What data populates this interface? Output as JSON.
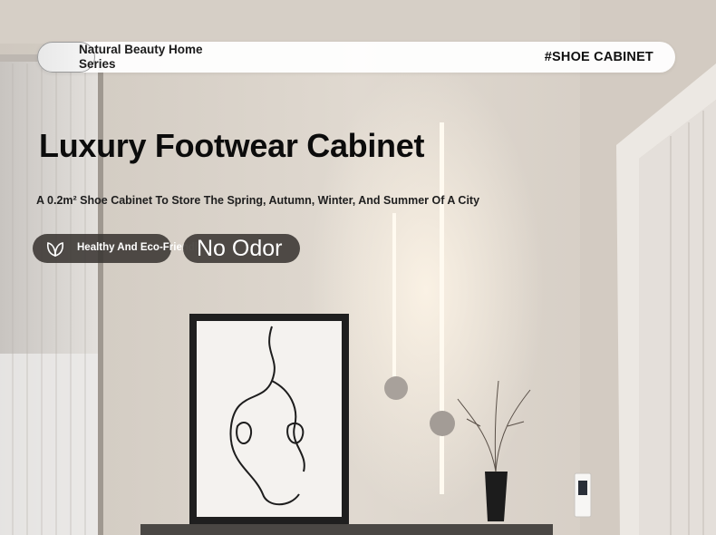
{
  "header": {
    "series_label": "Natural Beauty Home Series",
    "hashtag": "#SHOE CABINET"
  },
  "hero": {
    "title": "Luxury Footwear Cabinet",
    "subtitle": "A 0.2m² Shoe Cabinet To Store The Spring, Autumn, Winter, And Summer Of A City"
  },
  "badges": [
    {
      "label": "Healthy And Eco-Friendly",
      "icon": "leaf-icon"
    },
    {
      "label": "No Odor"
    }
  ],
  "colors": {
    "badge_bg": "#3a3632",
    "wall": "#d9d2ca"
  }
}
